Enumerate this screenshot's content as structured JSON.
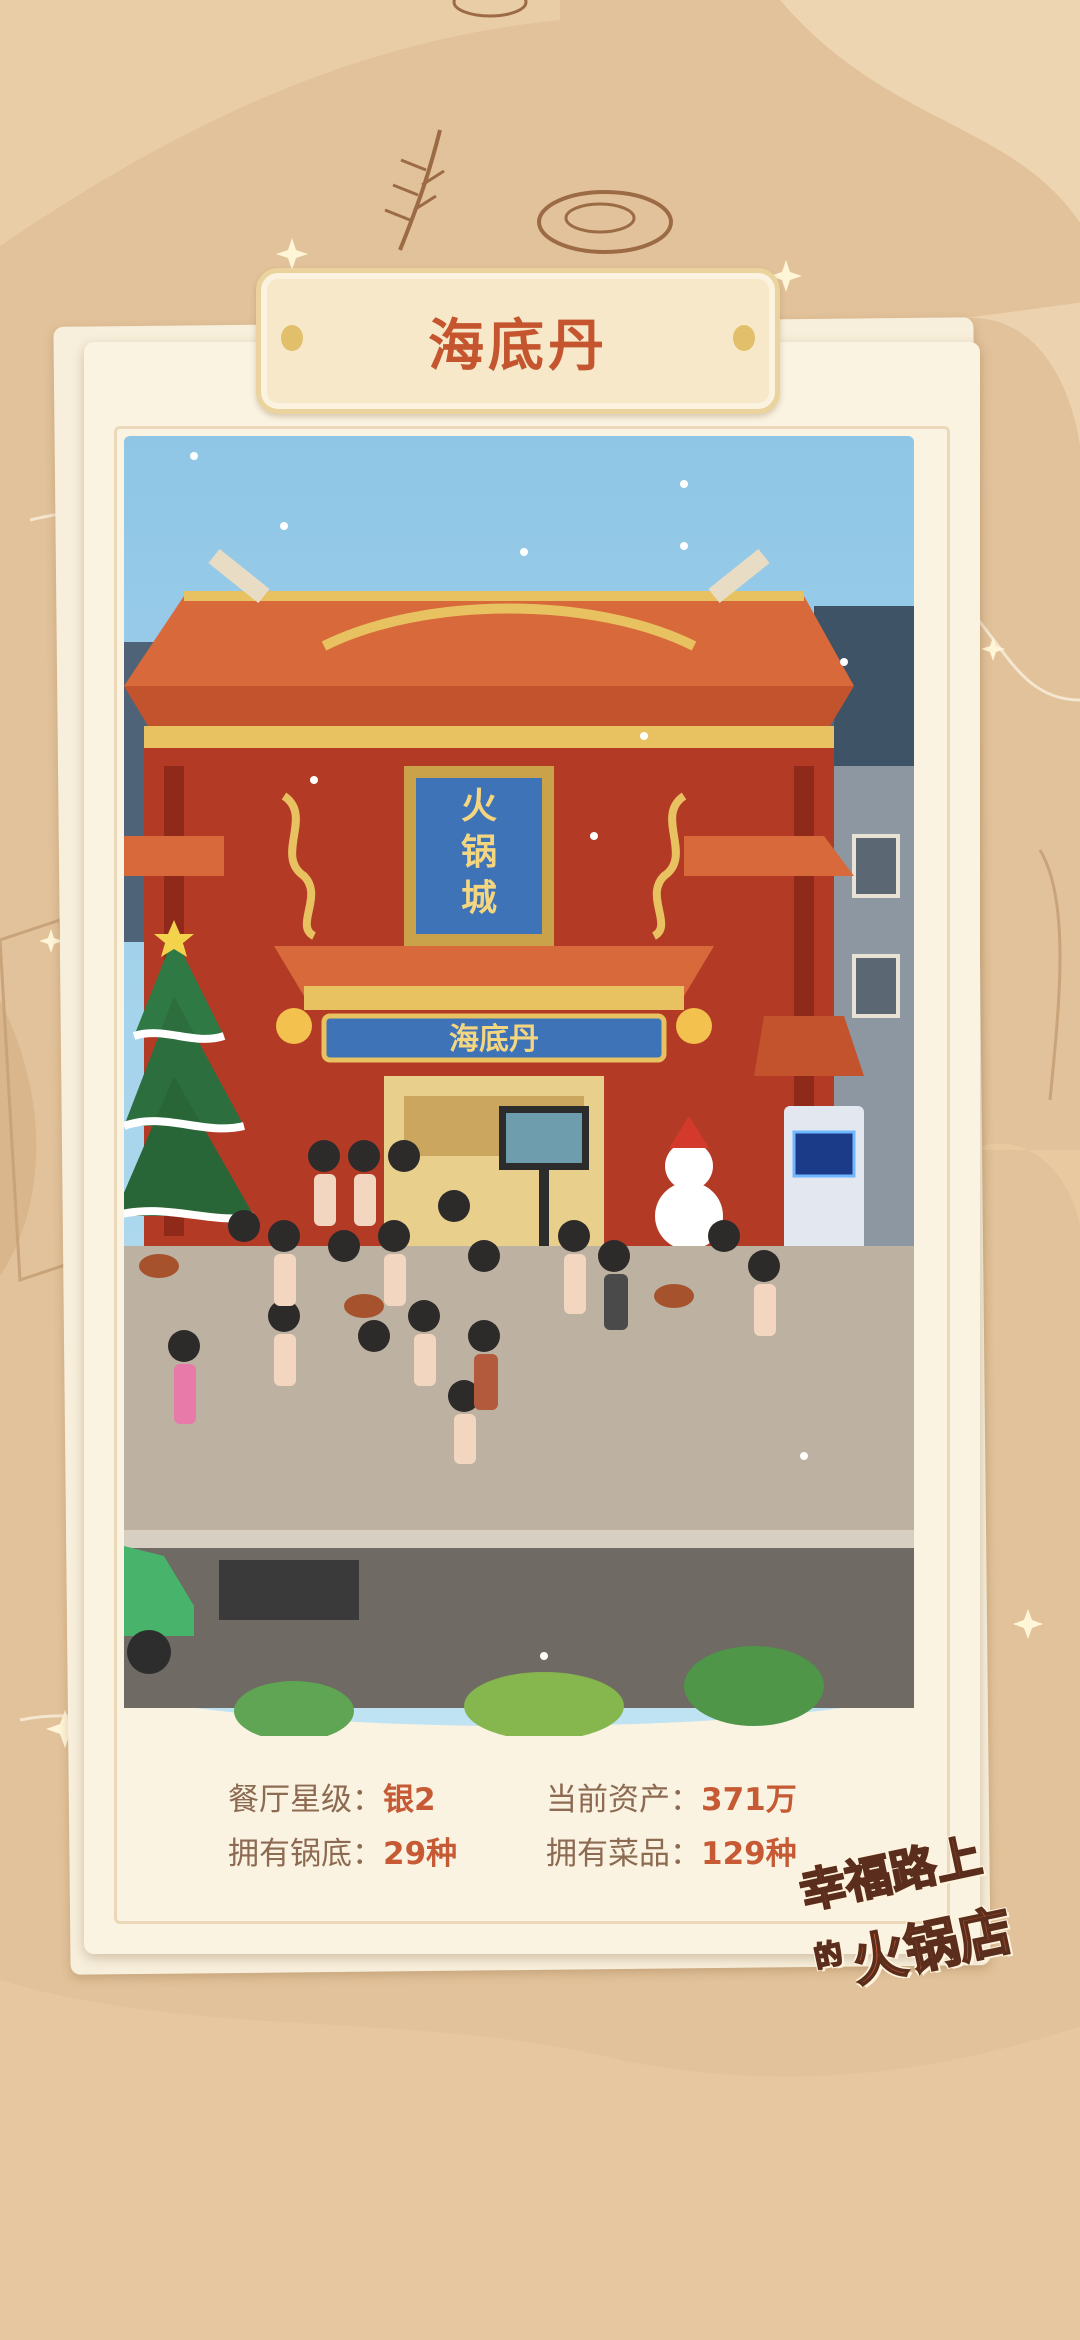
{
  "restaurant": {
    "name": "海底丹"
  },
  "scene": {
    "signboard": "火锅城",
    "shop_name": "海底丹"
  },
  "stats": {
    "star_label": "餐厅星级：",
    "star_value": "银2",
    "assets_label": "当前资产：",
    "assets_value": "371万",
    "pots_label": "拥有锅底：",
    "pots_value": "29种",
    "dishes_label": "拥有菜品：",
    "dishes_value": "129种"
  },
  "logo": {
    "line1": "幸福路上",
    "small": "的",
    "line2": "火锅店"
  },
  "colors": {
    "background": "#e2c29a",
    "card": "#faf3e2",
    "accent_red": "#c65a34",
    "sky": "#a9d6ec"
  }
}
